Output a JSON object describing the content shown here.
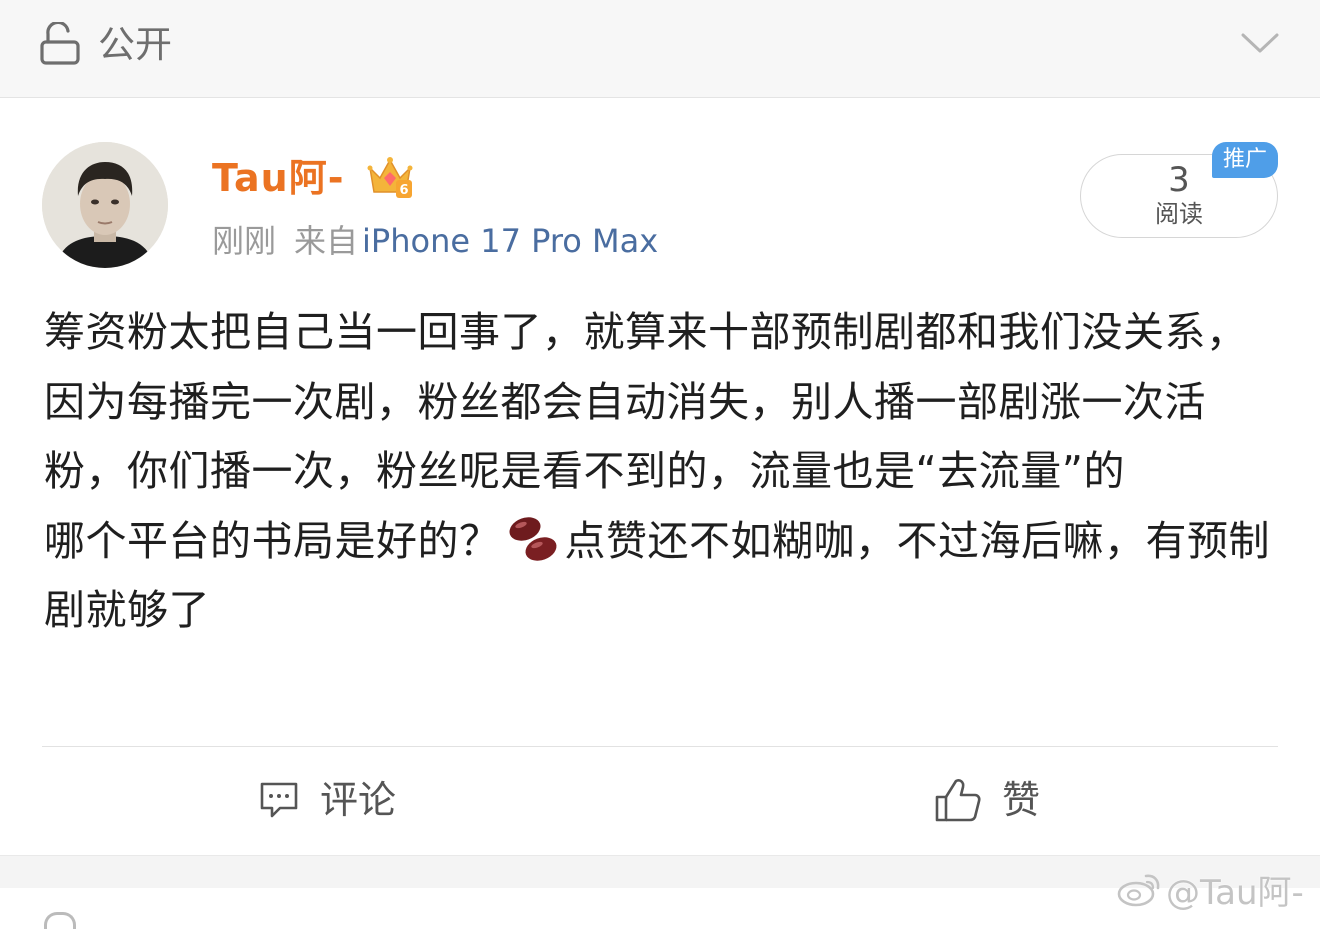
{
  "header": {
    "privacy_label": "公开",
    "lock_icon": "lock-open-icon",
    "expand_icon": "chevron-down-icon"
  },
  "post": {
    "username": "Tau阿-",
    "time": "刚刚",
    "from_label": "来自",
    "device": "iPhone 17 Pro Max",
    "read_count": "3",
    "read_label": "阅读",
    "promo_badge": "推广",
    "paragraph1": "筹资粉太把自己当一回事了，就算来十部预制剧都和我们没关系，因为每播完一次剧，粉丝都会自动消失，别人播一部剧涨一次活粉，你们播一次，粉丝呢是看不到的，流量也是“去流量”的",
    "paragraph2_before": "哪个平台的书局是好的？",
    "paragraph2_after": "点赞还不如糊咖，不过海后嘛，有预制剧就够了"
  },
  "actions": {
    "comment_label": "评论",
    "like_label": "赞"
  },
  "watermark": {
    "text": "@Tau阿-"
  },
  "colors": {
    "username": "#eb7322",
    "device_link": "#4a6da0",
    "promo_badge": "#4f9ee8"
  }
}
